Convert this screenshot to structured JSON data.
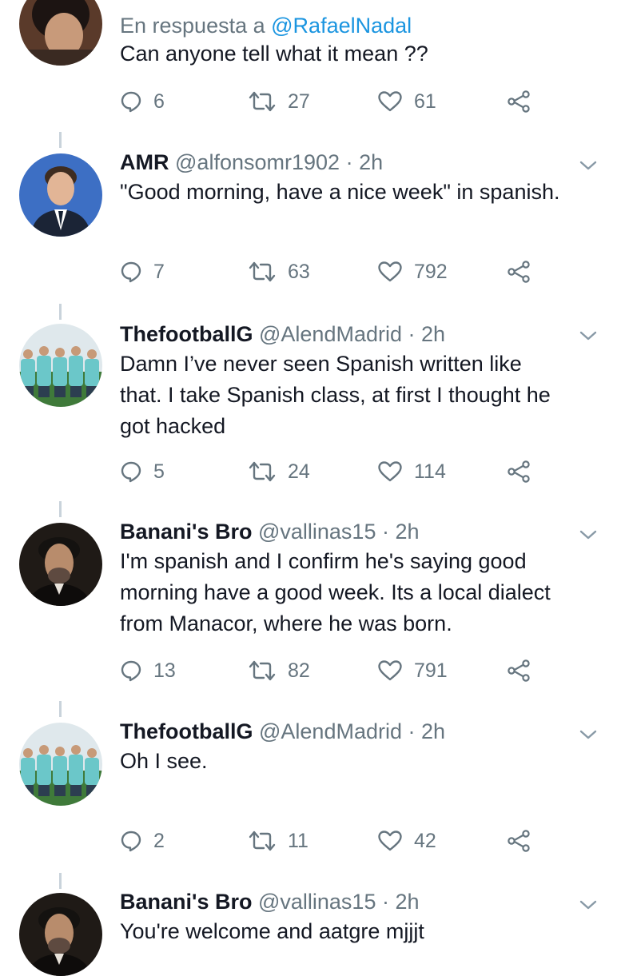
{
  "tweets": [
    {
      "reply_prefix": "En respuesta a",
      "reply_mention": "@RafaelNadal",
      "text": [
        "Can anyone tell what it mean ??"
      ],
      "replies": "6",
      "retweets": "27",
      "likes": "61"
    },
    {
      "name": "AMR",
      "handle": "@alfonsomr1902",
      "dot": "·",
      "time": "2h",
      "text": [
        "\"Good morning, have a nice week\" in spanish."
      ],
      "replies": "7",
      "retweets": "63",
      "likes": "792"
    },
    {
      "name": "ThefootballG",
      "handle": "@AlendMadrid",
      "dot": "·",
      "time": "2h",
      "text": [
        "Damn I’ve never seen Spanish written like",
        "that. I take Spanish class, at first I thought he",
        "got hacked"
      ],
      "replies": "5",
      "retweets": "24",
      "likes": "114"
    },
    {
      "name": "Banani's Bro",
      "handle": "@vallinas15",
      "dot": "·",
      "time": "2h",
      "text": [
        "I'm spanish and I confirm he's saying good",
        "morning have a good week. Its a local dialect",
        "from Manacor, where he was born."
      ],
      "replies": "13",
      "retweets": "82",
      "likes": "791"
    },
    {
      "name": "ThefootballG",
      "handle": "@AlendMadrid",
      "dot": "·",
      "time": "2h",
      "text": [
        "Oh I see."
      ],
      "replies": "2",
      "retweets": "11",
      "likes": "42"
    },
    {
      "name": "Banani's Bro",
      "handle": "@vallinas15",
      "dot": "·",
      "time": "2h",
      "text": [
        "You're welcome and aatgre mjjjt"
      ]
    }
  ],
  "icons": {
    "reply": "reply-icon",
    "retweet": "retweet-icon",
    "like": "heart-icon",
    "share": "share-icon",
    "more": "chevron-down-icon"
  },
  "colors": {
    "text": "#141823",
    "secondary": "#66757f",
    "link": "#1b95e0",
    "thread": "#c9d3db"
  }
}
